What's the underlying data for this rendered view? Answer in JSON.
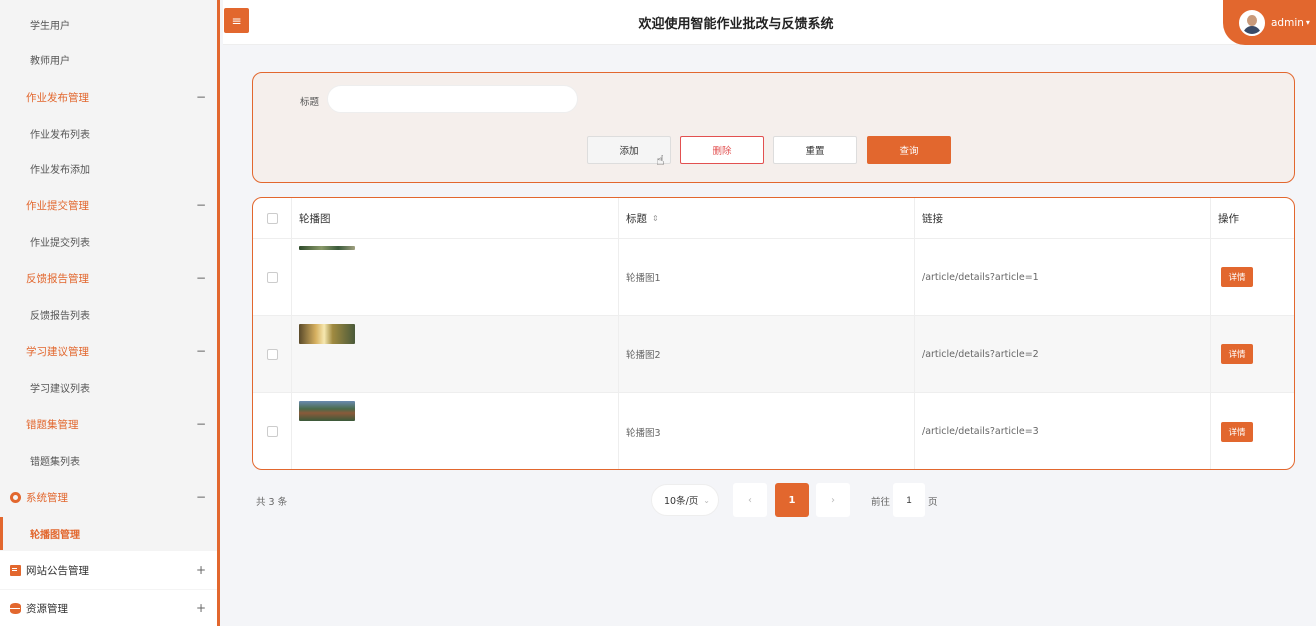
{
  "sidebar": {
    "items": [
      {
        "label": "学生用户"
      },
      {
        "label": "教师用户"
      },
      {
        "label": "作业发布管理",
        "sign": "−"
      },
      {
        "label": "作业发布列表"
      },
      {
        "label": "作业发布添加"
      },
      {
        "label": "作业提交管理",
        "sign": "−"
      },
      {
        "label": "作业提交列表"
      },
      {
        "label": "反馈报告管理",
        "sign": "−"
      },
      {
        "label": "反馈报告列表"
      },
      {
        "label": "学习建议管理",
        "sign": "−"
      },
      {
        "label": "学习建议列表"
      },
      {
        "label": "错题集管理",
        "sign": "−"
      },
      {
        "label": "错题集列表"
      },
      {
        "label": "系统管理",
        "sign": "−"
      },
      {
        "label": "轮播图管理"
      },
      {
        "label": "网站公告管理",
        "sign": "+"
      },
      {
        "label": "资源管理",
        "sign": "+"
      }
    ]
  },
  "header": {
    "menu_icon": "≡",
    "title": "欢迎使用智能作业批改与反馈系统",
    "user": "admin",
    "user_caret": "▾"
  },
  "search": {
    "label": "标题",
    "value": "",
    "add": "添加",
    "delete": "删除",
    "reset": "重置",
    "query": "查询"
  },
  "table": {
    "headers": {
      "image": "轮播图",
      "title": "标题",
      "sort_icon": "⇕",
      "link": "链接",
      "action": "操作"
    },
    "rows": [
      {
        "title": "轮播图1",
        "link": "/article/details?article=1",
        "action": "详情"
      },
      {
        "title": "轮播图2",
        "link": "/article/details?article=2",
        "action": "详情"
      },
      {
        "title": "轮播图3",
        "link": "/article/details?article=3",
        "action": "详情"
      }
    ]
  },
  "pagination": {
    "total": "共 3 条",
    "page_size": "10条/页",
    "page_size_caret": "⌄",
    "prev": "‹",
    "current": "1",
    "next": "›",
    "goto_label": "前往",
    "goto_value": "1",
    "goto_unit": "页"
  },
  "colors": {
    "accent": "#e2672e",
    "danger": "#e25050"
  }
}
